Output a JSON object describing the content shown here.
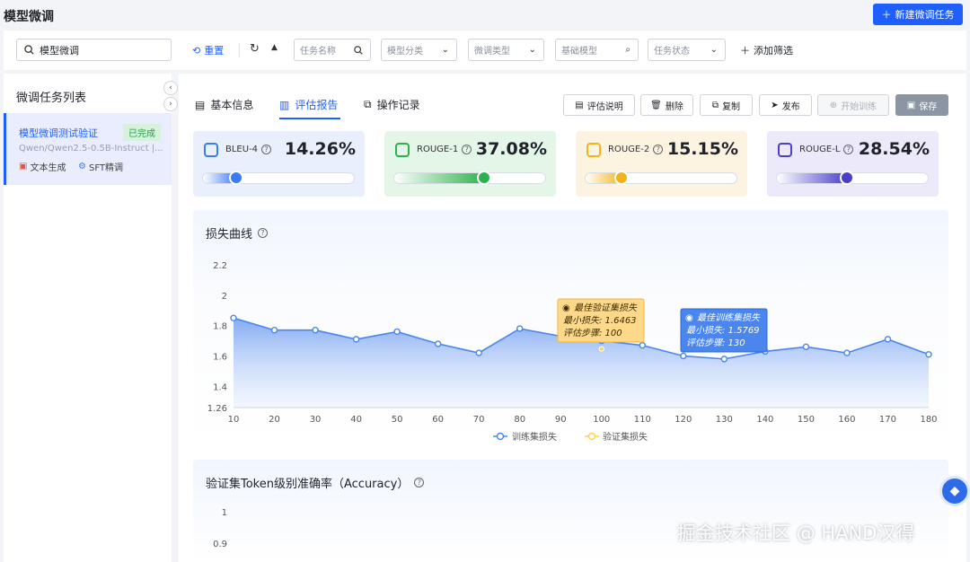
{
  "header": {
    "title": "模型微调",
    "new_task_label": "新建微调任务"
  },
  "filters": {
    "search_value": "模型微调",
    "reset_label": "重置",
    "task_name_placeholder": "任务名称",
    "model_category": "模型分类",
    "finetune_type": "微调类型",
    "base_model": "基础模型",
    "task_status": "任务状态",
    "add_filter_label": "添加筛选"
  },
  "sidebar": {
    "title": "微调任务列表",
    "task": {
      "name": "模型微调测试验证",
      "status": "已完成",
      "model": "Qwen/Qwen2.5-0.5B-Instruct |...",
      "tags": [
        "文本生成",
        "SFT精调"
      ]
    }
  },
  "tabs": [
    {
      "label": "基本信息"
    },
    {
      "label": "评估报告"
    },
    {
      "label": "操作记录"
    }
  ],
  "actions": {
    "explain": "评估说明",
    "delete": "删除",
    "copy": "复制",
    "publish": "发布",
    "start": "开始训练",
    "save": "保存"
  },
  "metrics": [
    {
      "name": "BLEU-4",
      "value": "14.26%",
      "level": 0.14,
      "color": "#3b7cf0",
      "bg": "#e9effd"
    },
    {
      "name": "ROUGE-1",
      "value": "37.08%",
      "level": 0.37,
      "color": "#2fb04e",
      "bg": "#e3f6e8"
    },
    {
      "name": "ROUGE-2",
      "value": "15.15%",
      "level": 0.15,
      "color": "#f3b41b",
      "bg": "#fdf3e1"
    },
    {
      "name": "ROUGE-L",
      "value": "28.54%",
      "level": 0.29,
      "color": "#4b3fc9",
      "bg": "#ece9fb"
    }
  ],
  "loss_chart": {
    "title": "损失曲线",
    "tooltip_val": {
      "title": "最佳验证集损失",
      "min_loss": "最小损失: 1.6463",
      "step": "评估步骤: 100"
    },
    "tooltip_train": {
      "title": "最佳训练集损失",
      "min_loss": "最小损失: 1.5769",
      "step": "评估步骤: 130"
    }
  },
  "chart_data": {
    "type": "area",
    "title": "损失曲线",
    "x": [
      10,
      20,
      30,
      40,
      50,
      60,
      70,
      80,
      90,
      100,
      110,
      120,
      130,
      140,
      150,
      160,
      170,
      180
    ],
    "series": [
      {
        "name": "训练集损失",
        "values": [
          1.85,
          1.77,
          1.77,
          1.71,
          1.76,
          1.68,
          1.62,
          1.78,
          1.73,
          1.7,
          1.67,
          1.6,
          1.58,
          1.63,
          1.66,
          1.62,
          1.71,
          1.61
        ]
      },
      {
        "name": "验证集损失",
        "x": [
          100
        ],
        "values": [
          1.6463
        ]
      }
    ],
    "ylim": [
      1.26,
      2.2
    ],
    "yticks": [
      "2.2",
      "2",
      "1.8",
      "1.6",
      "1.4",
      "1.26"
    ],
    "xticks": [
      "10",
      "20",
      "30",
      "40",
      "50",
      "60",
      "70",
      "80",
      "90",
      "100",
      "110",
      "120",
      "130",
      "140",
      "150",
      "160",
      "170",
      "180"
    ],
    "legend_position": "bottom"
  },
  "accuracy_chart": {
    "title": "验证集Token级别准确率（Accuracy）",
    "yticks": [
      "1",
      "0.9"
    ]
  },
  "watermark": "掘金技术社区 @ HAND汉得"
}
